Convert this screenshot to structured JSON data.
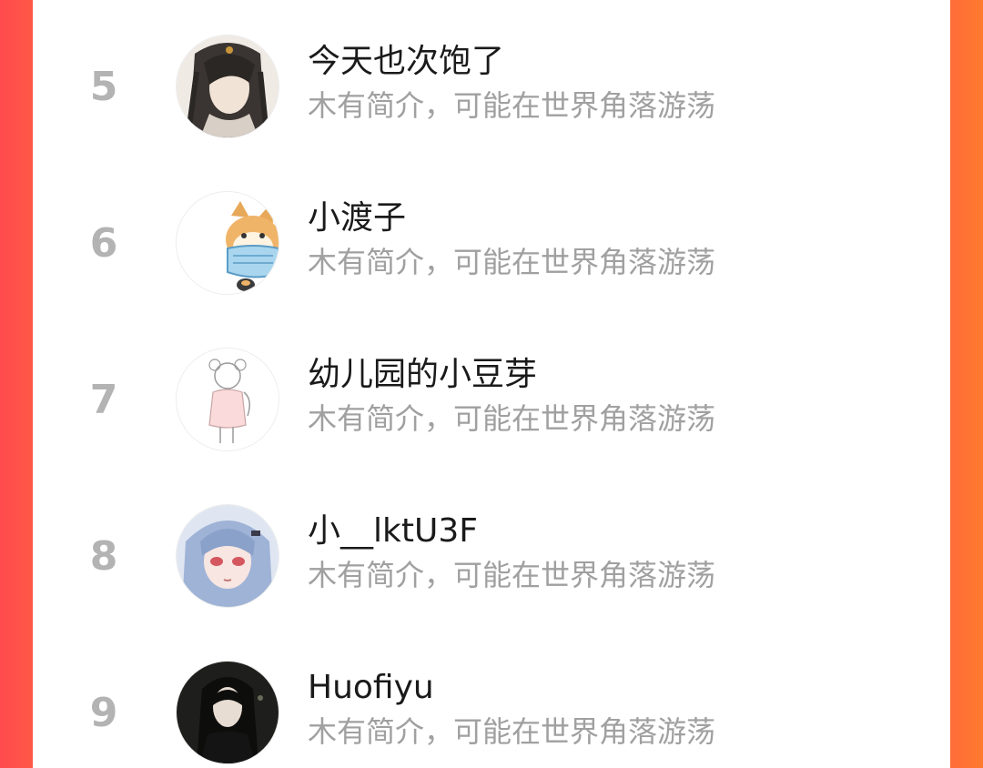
{
  "colors": {
    "rank": "#b3b3b3",
    "name": "#1a1a1a",
    "bio": "#a0a0a0",
    "background_left": "#ff4a4e",
    "background_right": "#ff7a2e"
  },
  "ranking": {
    "items": [
      {
        "rank": "5",
        "name": "今天也次饱了",
        "bio": "木有简介，可能在世界角落游荡",
        "avatar_icon": "anime-long-hair-man-avatar-icon"
      },
      {
        "rank": "6",
        "name": "小渡子",
        "bio": "木有简介，可能在世界角落游荡",
        "avatar_icon": "masked-dog-avatar-icon"
      },
      {
        "rank": "7",
        "name": "幼儿园的小豆芽",
        "bio": "木有简介，可能在世界角落游荡",
        "avatar_icon": "sketch-girl-avatar-icon"
      },
      {
        "rank": "8",
        "name": "小__lktU3F",
        "bio": "木有简介，可能在世界角落游荡",
        "avatar_icon": "anime-blue-hair-girl-avatar-icon"
      },
      {
        "rank": "9",
        "name": "Huofiyu",
        "bio": "木有简介，可能在世界角落游荡",
        "avatar_icon": "dark-photo-girl-avatar-icon"
      }
    ]
  }
}
